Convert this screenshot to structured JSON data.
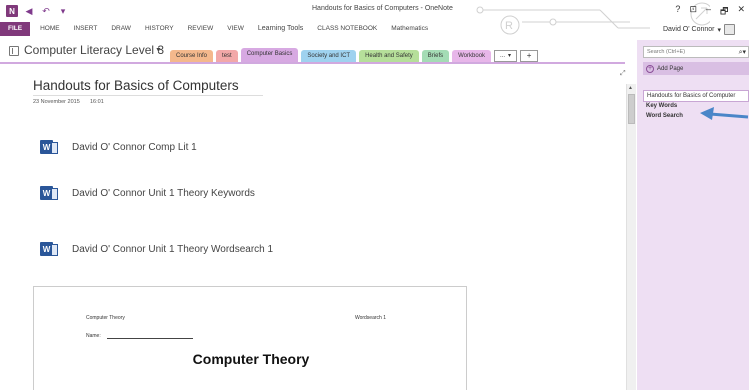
{
  "app": {
    "window_title": "Handouts for Basics of Computers - OneNote",
    "logo_letter": "N",
    "user_name": "David O' Connor"
  },
  "window_controls": [
    "?",
    "⊡",
    "–",
    "🗗",
    "✕"
  ],
  "ribbon": {
    "tabs": [
      "FILE",
      "HOME",
      "INSERT",
      "DRAW",
      "HISTORY",
      "REVIEW",
      "VIEW",
      "Learning Tools",
      "CLASS NOTEBOOK",
      "Mathematics"
    ]
  },
  "notebook": {
    "name": "Computer Literacy Level 3"
  },
  "sections": [
    {
      "label": "Course Info",
      "color": "#f4b88c"
    },
    {
      "label": "test",
      "color": "#f2a8a8"
    },
    {
      "label": "Computer Basics",
      "color": "#d7a9e2",
      "active": true
    },
    {
      "label": "Society and ICT",
      "color": "#9fd2ef"
    },
    {
      "label": "Health and Safety",
      "color": "#b6df9a"
    },
    {
      "label": "Briefs",
      "color": "#a4dcb5"
    },
    {
      "label": "Workbook",
      "color": "#e7b6e9"
    }
  ],
  "section_more": "...",
  "section_add": "+",
  "page": {
    "title": "Handouts for Basics of Computers",
    "date": "23 November 2015",
    "time": "16:01",
    "files": [
      "David O' Connor Comp Lit 1",
      "David O' Connor Unit 1 Theory Keywords",
      "David O' Connor Unit 1 Theory Wordsearch 1"
    ],
    "preview": {
      "course": "Computer Theory",
      "tag": "Wordsearch 1",
      "name_label": "Name:",
      "heading": "Computer Theory"
    }
  },
  "pane": {
    "search_placeholder": "Search (Ctrl+E)",
    "add_page": "Add Page",
    "pages": [
      {
        "label": "Handouts for Basics of Computer",
        "selected": true
      },
      {
        "label": "Key Words",
        "sub": true
      },
      {
        "label": "Word Search",
        "sub": true
      }
    ]
  },
  "colors": {
    "accent": "#80397b",
    "pane": "#eedff3",
    "arrow": "#4a86c8",
    "word_icon": "#2a5699"
  }
}
